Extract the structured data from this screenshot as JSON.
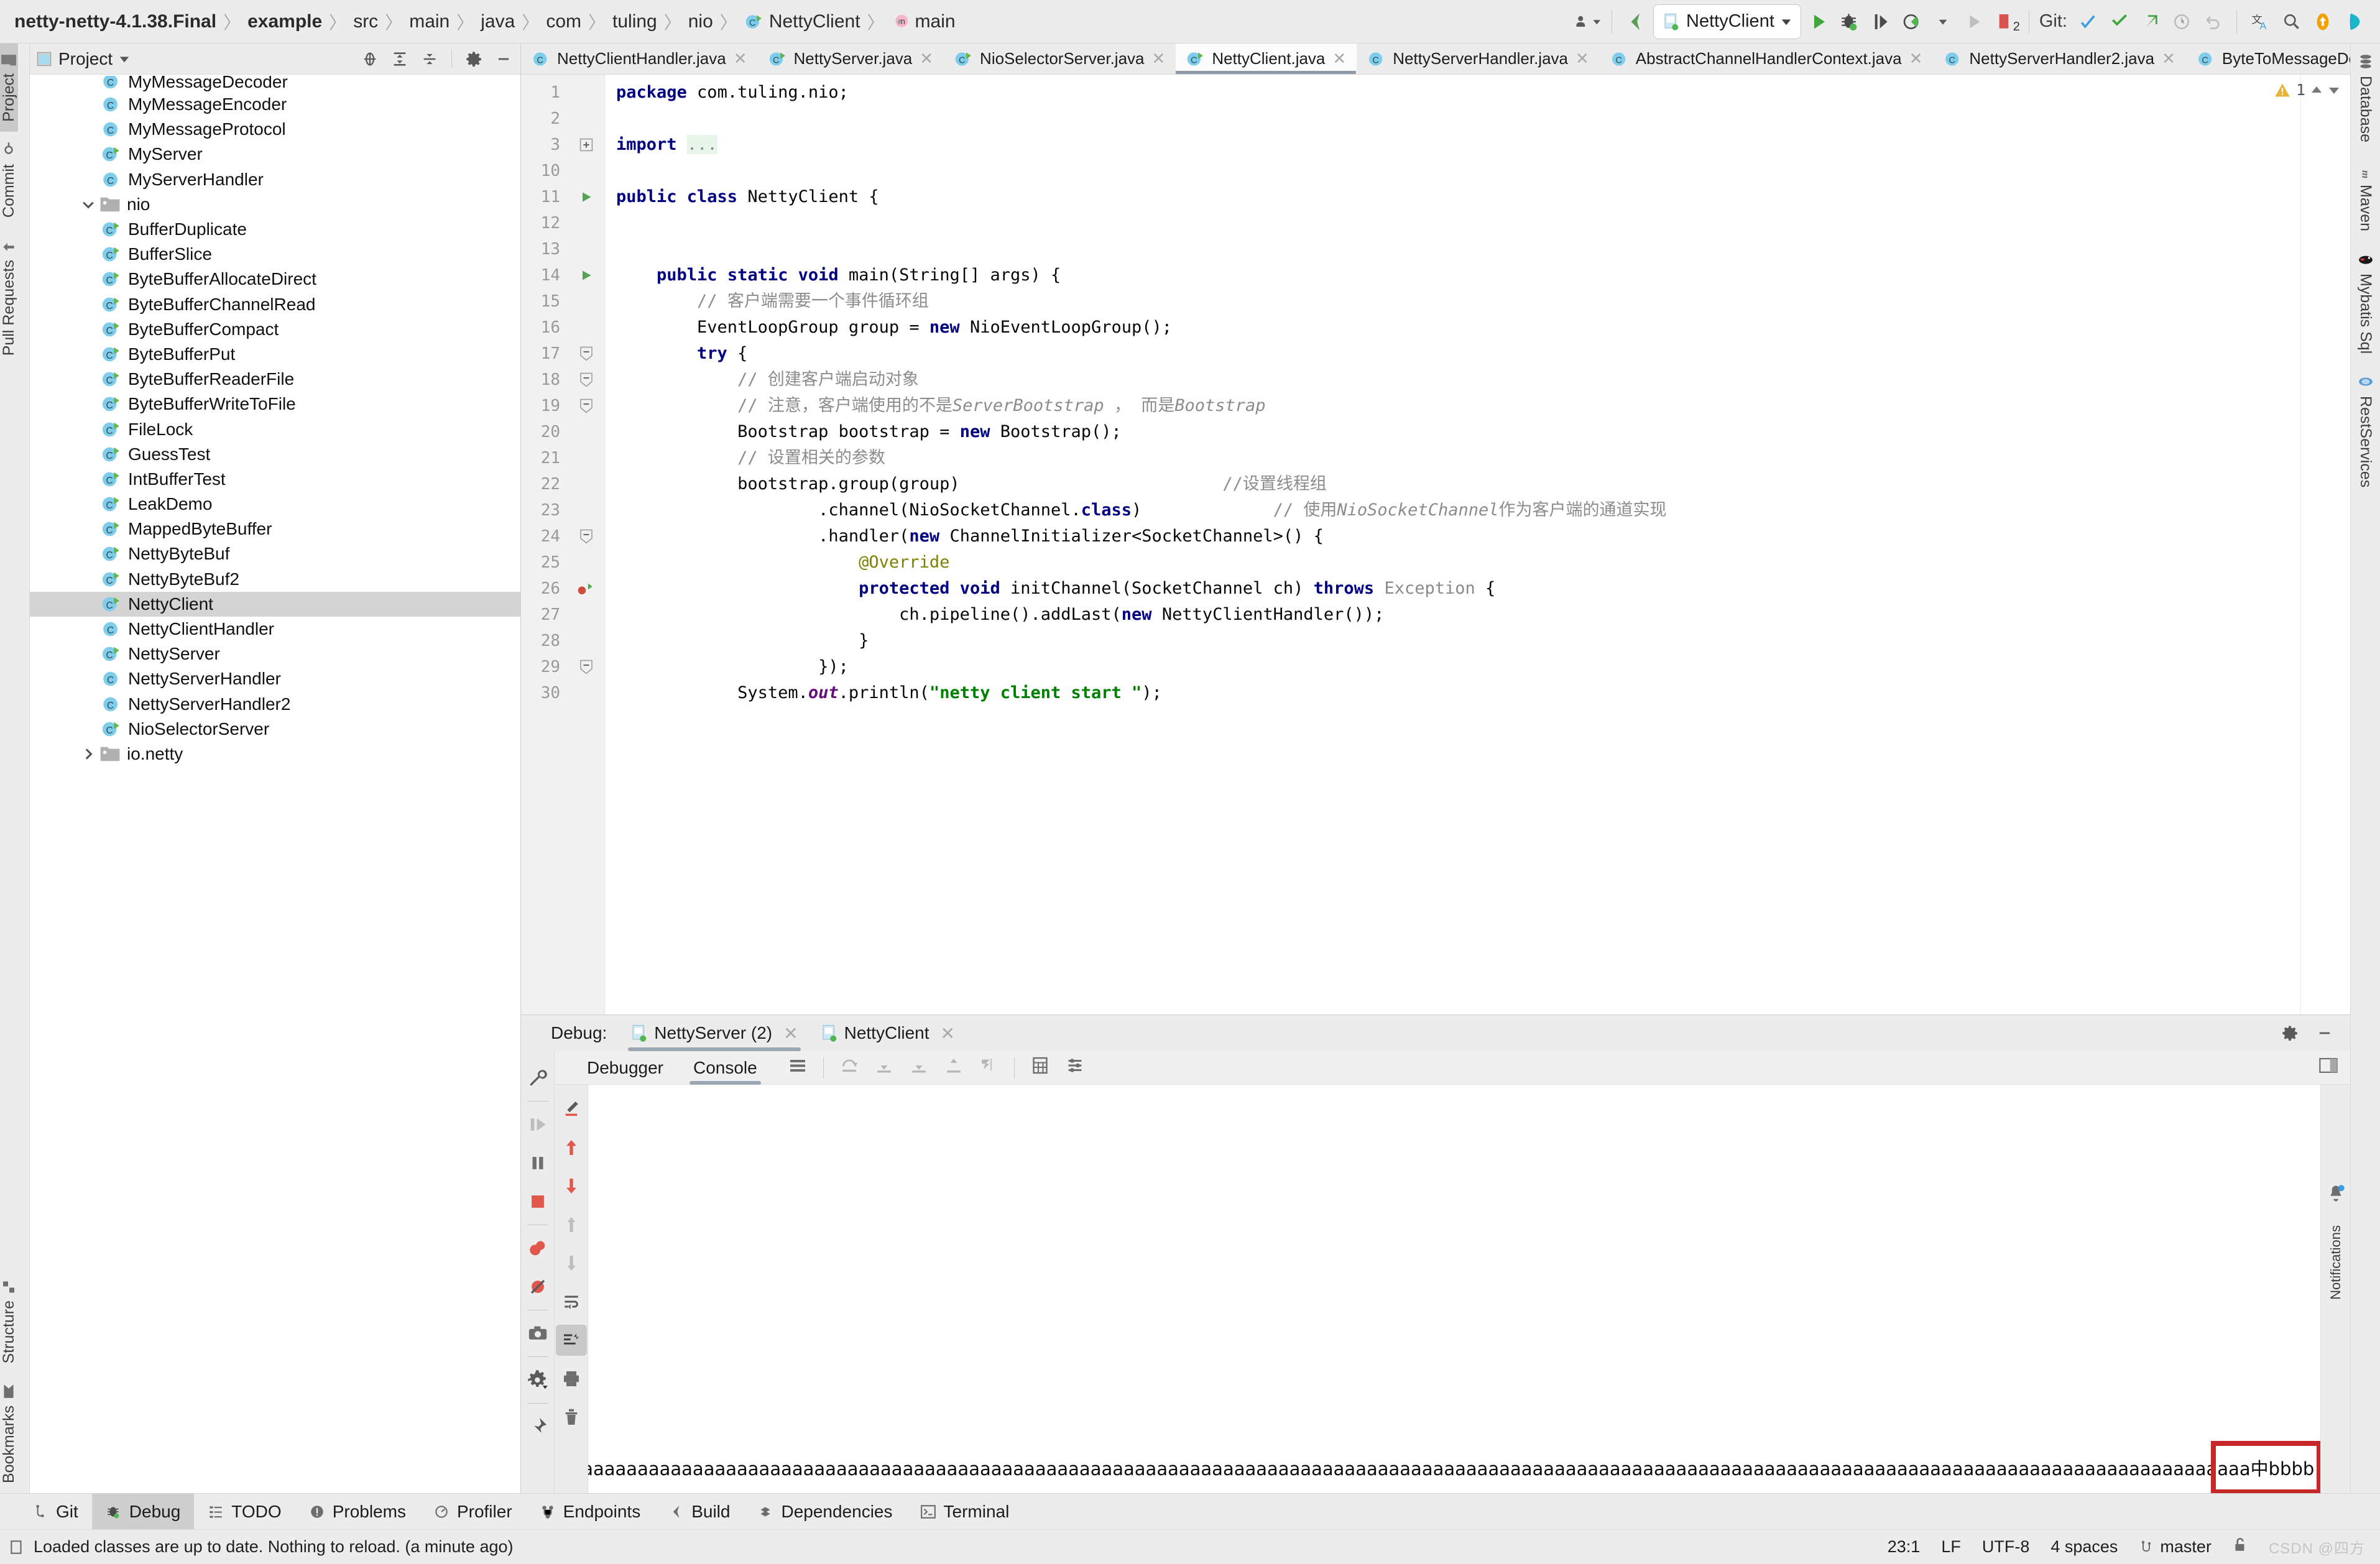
{
  "breadcrumb": {
    "items": [
      {
        "label": "netty-netty-4.1.38.Final",
        "bold": true,
        "icon": ""
      },
      {
        "label": "example",
        "bold": true,
        "icon": ""
      },
      {
        "label": "src",
        "bold": false,
        "icon": ""
      },
      {
        "label": "main",
        "bold": false,
        "icon": ""
      },
      {
        "label": "java",
        "bold": false,
        "icon": ""
      },
      {
        "label": "com",
        "bold": false,
        "icon": ""
      },
      {
        "label": "tuling",
        "bold": false,
        "icon": ""
      },
      {
        "label": "nio",
        "bold": false,
        "icon": ""
      },
      {
        "label": "NettyClient",
        "bold": false,
        "icon": "class-icon"
      },
      {
        "label": "main",
        "bold": false,
        "icon": "method-icon"
      }
    ]
  },
  "toolbar": {
    "run_config": "NettyClient",
    "git_label": "Git:",
    "icons": [
      "profiler-icon",
      "back-arrow-icon",
      "run-icon",
      "debug-icon",
      "rerun-icon",
      "coverage-icon",
      "stop-icon",
      "breakpoint-icon",
      "git-update-icon",
      "git-commit-icon",
      "git-push-icon",
      "history-icon",
      "rollback-icon",
      "translate-icon",
      "search-icon",
      "updates-icon",
      "ide-icon"
    ],
    "breakpoint_count": "2"
  },
  "left_stripe": {
    "top_items": [
      {
        "label": "Project",
        "icon": "project-folder-icon",
        "active": true
      },
      {
        "label": "Commit",
        "icon": "commit-icon",
        "active": false
      },
      {
        "label": "Pull Requests",
        "icon": "pull-request-icon",
        "active": false
      }
    ],
    "bottom_items": [
      {
        "label": "Structure",
        "icon": "structure-icon"
      },
      {
        "label": "Bookmarks",
        "icon": "bookmark-icon"
      }
    ]
  },
  "right_stripe": {
    "items": [
      {
        "label": "Database",
        "icon": "database-icon"
      },
      {
        "label": "Maven",
        "icon": "maven-icon"
      },
      {
        "label": "Mybatis Sql",
        "icon": "mybatis-icon"
      },
      {
        "label": "RestServices",
        "icon": "restservices-icon"
      }
    ]
  },
  "project_panel": {
    "title": "Project",
    "header_icons": [
      "locate-icon",
      "expand-all-icon",
      "collapse-all-icon",
      "gear-icon",
      "minimize-icon"
    ],
    "tree": [
      {
        "label": "MyMessageDecoder",
        "indent": 3,
        "icon": "class-icon",
        "runnable": false,
        "partial": true,
        "selected": false
      },
      {
        "label": "MyMessageEncoder",
        "indent": 3,
        "icon": "class-icon",
        "runnable": false,
        "selected": false
      },
      {
        "label": "MyMessageProtocol",
        "indent": 3,
        "icon": "class-icon",
        "runnable": false,
        "selected": false
      },
      {
        "label": "MyServer",
        "indent": 3,
        "icon": "class-icon",
        "runnable": true,
        "selected": false
      },
      {
        "label": "MyServerHandler",
        "indent": 3,
        "icon": "class-icon",
        "runnable": false,
        "selected": false
      },
      {
        "label": "nio",
        "indent": 2,
        "icon": "folder-icon",
        "expanded": true,
        "selected": false
      },
      {
        "label": "BufferDuplicate",
        "indent": 3,
        "icon": "class-icon",
        "runnable": true,
        "selected": false
      },
      {
        "label": "BufferSlice",
        "indent": 3,
        "icon": "class-icon",
        "runnable": true,
        "selected": false
      },
      {
        "label": "ByteBufferAllocateDirect",
        "indent": 3,
        "icon": "class-icon",
        "runnable": true,
        "selected": false
      },
      {
        "label": "ByteBufferChannelRead",
        "indent": 3,
        "icon": "class-icon",
        "runnable": true,
        "selected": false
      },
      {
        "label": "ByteBufferCompact",
        "indent": 3,
        "icon": "class-icon",
        "runnable": true,
        "selected": false
      },
      {
        "label": "ByteBufferPut",
        "indent": 3,
        "icon": "class-icon",
        "runnable": true,
        "selected": false
      },
      {
        "label": "ByteBufferReaderFile",
        "indent": 3,
        "icon": "class-icon",
        "runnable": true,
        "selected": false
      },
      {
        "label": "ByteBufferWriteToFile",
        "indent": 3,
        "icon": "class-icon",
        "runnable": true,
        "selected": false
      },
      {
        "label": "FileLock",
        "indent": 3,
        "icon": "class-icon",
        "runnable": true,
        "selected": false
      },
      {
        "label": "GuessTest",
        "indent": 3,
        "icon": "class-icon",
        "runnable": true,
        "selected": false
      },
      {
        "label": "IntBufferTest",
        "indent": 3,
        "icon": "class-icon",
        "runnable": true,
        "selected": false
      },
      {
        "label": "LeakDemo",
        "indent": 3,
        "icon": "class-icon",
        "runnable": true,
        "selected": false
      },
      {
        "label": "MappedByteBuffer",
        "indent": 3,
        "icon": "class-icon",
        "runnable": true,
        "selected": false
      },
      {
        "label": "NettyByteBuf",
        "indent": 3,
        "icon": "class-icon",
        "runnable": true,
        "selected": false
      },
      {
        "label": "NettyByteBuf2",
        "indent": 3,
        "icon": "class-icon",
        "runnable": true,
        "selected": false
      },
      {
        "label": "NettyClient",
        "indent": 3,
        "icon": "class-icon",
        "runnable": true,
        "selected": true
      },
      {
        "label": "NettyClientHandler",
        "indent": 3,
        "icon": "class-icon",
        "runnable": false,
        "selected": false
      },
      {
        "label": "NettyServer",
        "indent": 3,
        "icon": "class-icon",
        "runnable": true,
        "selected": false
      },
      {
        "label": "NettyServerHandler",
        "indent": 3,
        "icon": "class-icon",
        "runnable": false,
        "selected": false
      },
      {
        "label": "NettyServerHandler2",
        "indent": 3,
        "icon": "class-icon",
        "runnable": false,
        "selected": false
      },
      {
        "label": "NioSelectorServer",
        "indent": 3,
        "icon": "class-icon",
        "runnable": true,
        "selected": false
      },
      {
        "label": "io.netty",
        "indent": 2,
        "icon": "folder-icon",
        "expanded": false,
        "selected": false
      }
    ]
  },
  "editor": {
    "tabs": [
      {
        "label": "NettyClientHandler.java",
        "active": false,
        "runnable": false
      },
      {
        "label": "NettyServer.java",
        "active": false,
        "runnable": true
      },
      {
        "label": "NioSelectorServer.java",
        "active": false,
        "runnable": true
      },
      {
        "label": "NettyClient.java",
        "active": true,
        "runnable": true
      },
      {
        "label": "NettyServerHandler.java",
        "active": false,
        "runnable": false
      },
      {
        "label": "AbstractChannelHandlerContext.java",
        "active": false,
        "runnable": false
      },
      {
        "label": "NettyServerHandler2.java",
        "active": false,
        "runnable": false
      },
      {
        "label": "ByteToMessageDecoder.java",
        "active": false,
        "runnable": false
      }
    ],
    "warning_count": "1",
    "lines": [
      {
        "num": "1",
        "marker": "",
        "fold": "",
        "html": "<span class=\"kw\">package</span> com.tuling.nio;"
      },
      {
        "num": "2",
        "marker": "",
        "fold": "",
        "html": ""
      },
      {
        "num": "3",
        "marker": "",
        "fold": "plus",
        "html": "<span class=\"kw\">import</span> <span class=\"hl gray\">...</span>"
      },
      {
        "num": "10",
        "marker": "",
        "fold": "",
        "html": ""
      },
      {
        "num": "11",
        "marker": "run",
        "fold": "",
        "html": "<span class=\"kw\">public class</span> NettyClient {"
      },
      {
        "num": "12",
        "marker": "",
        "fold": "",
        "html": ""
      },
      {
        "num": "13",
        "marker": "",
        "fold": "",
        "html": ""
      },
      {
        "num": "14",
        "marker": "run",
        "fold": "minus",
        "html": "    <span class=\"kw\">public static void</span> main(String[] args) {"
      },
      {
        "num": "15",
        "marker": "",
        "fold": "",
        "html": "        <span class=\"cm\">// 客户端需要一个事件循环组</span>"
      },
      {
        "num": "16",
        "marker": "",
        "fold": "",
        "html": "        EventLoopGroup group = <span class=\"kw\">new</span> NioEventLoopGroup();"
      },
      {
        "num": "17",
        "marker": "",
        "fold": "minus",
        "html": "        <span class=\"kw\">try</span> {"
      },
      {
        "num": "18",
        "marker": "",
        "fold": "minus",
        "html": "            <span class=\"cm\">// 创建客户端启动对象</span>"
      },
      {
        "num": "19",
        "marker": "",
        "fold": "minus",
        "html": "            <span class=\"cm\">// 注意，客户端使用的不是</span><span class=\"cmi\">ServerBootstrap</span><span class=\"cm\"> ， 而是</span><span class=\"cmi\">Bootstrap</span>"
      },
      {
        "num": "20",
        "marker": "",
        "fold": "",
        "html": "            Bootstrap bootstrap = <span class=\"kw\">new</span> Bootstrap();"
      },
      {
        "num": "21",
        "marker": "",
        "fold": "",
        "html": "            <span class=\"cm\">// 设置相关的参数</span>"
      },
      {
        "num": "22",
        "marker": "",
        "fold": "",
        "html": "            bootstrap.group(group)                          <span class=\"cm\">//设置线程组</span>"
      },
      {
        "num": "23",
        "marker": "",
        "fold": "",
        "html": "                    .channel(NioSocketChannel.<span class=\"kw\">class</span>)             <span class=\"cm\">// 使用</span><span class=\"cmi\">NioSocketChannel</span><span class=\"cm\">作为客户端的通道实现</span>"
      },
      {
        "num": "24",
        "marker": "",
        "fold": "minus",
        "html": "                    .handler(<span class=\"kw\">new</span> ChannelInitializer&lt;SocketChannel&gt;() {"
      },
      {
        "num": "25",
        "marker": "",
        "fold": "",
        "html": "                        <span class=\"an\">@Override</span>"
      },
      {
        "num": "26",
        "marker": "bp",
        "fold": "",
        "html": "                        <span class=\"kw\">protected void</span> initChannel(SocketChannel ch) <span class=\"kw\">throws</span> <span class=\"gray\">Exception</span> {"
      },
      {
        "num": "27",
        "marker": "",
        "fold": "",
        "html": "                            ch.pipeline().addLast(<span class=\"kw\">new</span> NettyClientHandler());"
      },
      {
        "num": "28",
        "marker": "",
        "fold": "",
        "html": "                        }"
      },
      {
        "num": "29",
        "marker": "",
        "fold": "minus",
        "html": "                    });"
      },
      {
        "num": "30",
        "marker": "",
        "fold": "",
        "html": "            System.<span class=\"purple\">out</span>.println(<span class=\"str\">\"netty client start \"</span>);"
      }
    ]
  },
  "debug": {
    "label": "Debug:",
    "tabs": [
      {
        "label": "NettyServer (2)",
        "active": true
      },
      {
        "label": "NettyClient",
        "active": false
      }
    ],
    "subtabs": [
      {
        "label": "Debugger",
        "active": false
      },
      {
        "label": "Console",
        "active": true
      }
    ],
    "left_tools": [
      "wrench-icon",
      "resume-icon",
      "pause-icon",
      "stop-icon",
      "mute-breakpoints-icon",
      "view-breakpoints-icon",
      "camera-icon",
      "settings-icon",
      "pin-icon"
    ],
    "console_tools": [
      "soft-wrap-icon",
      "scroll-up-icon",
      "scroll-down-icon",
      "prev-icon",
      "next-icon",
      "wrap-text-icon",
      "scroll-end-icon",
      "print-icon",
      "trash-icon"
    ],
    "console_output": "aaaaaaaaaaaaaaaaaaaaaaaaaaaaaaaaaaaaaaaaaaaaaaaaaaaaaaaaaaaaaaaaaaaaaaaaaaaaaaaaaaaaaaaaaaaaaaaaaaaaaaaaaaaaaaaaaaaaaaaaaaaaaaaaaaaaaaaaaaaaaaaaaaaaaaaaaaaaaaaaaaaaaaaaaaaaaaaaaaaaaaaaaaaaaaaaaaaaaaaaaaaaaaaaaaaaaaaaaaaaaaaaaaaaaaaaaaaaaaaaaaaaaaaaaaaaaaaaaaaaaaaaaaaaaaaaaaaaaaaaaaaaaaaaaaaaaaaaaaaaaaaaaaaaaaaaaaaaaaaaaaaaaaaaaaaaaaaaaaaaaaaaaaaaaaaaaaaaaaaaaaaa中bbbb",
    "highlight_text": "aaa中bbbb",
    "highlight_color": "#c62828"
  },
  "bottom_bar": {
    "buttons": [
      {
        "label": "Git",
        "icon": "git-branch-icon",
        "active": false
      },
      {
        "label": "Debug",
        "icon": "debug-bug-icon",
        "active": true
      },
      {
        "label": "TODO",
        "icon": "todo-icon",
        "active": false
      },
      {
        "label": "Problems",
        "icon": "problems-icon",
        "active": false
      },
      {
        "label": "Profiler",
        "icon": "profiler-icon",
        "active": false
      },
      {
        "label": "Endpoints",
        "icon": "endpoints-icon",
        "active": false
      },
      {
        "label": "Build",
        "icon": "build-icon",
        "active": false
      },
      {
        "label": "Dependencies",
        "icon": "dependencies-icon",
        "active": false
      },
      {
        "label": "Terminal",
        "icon": "terminal-icon",
        "active": false
      }
    ]
  },
  "status_bar": {
    "message": "Loaded classes are up to date. Nothing to reload. (a minute ago)",
    "caret_position": "23:1",
    "line_separator": "LF",
    "encoding": "UTF-8",
    "indent": "4 spaces",
    "branch": "master",
    "watermark": "CSDN @四方"
  }
}
